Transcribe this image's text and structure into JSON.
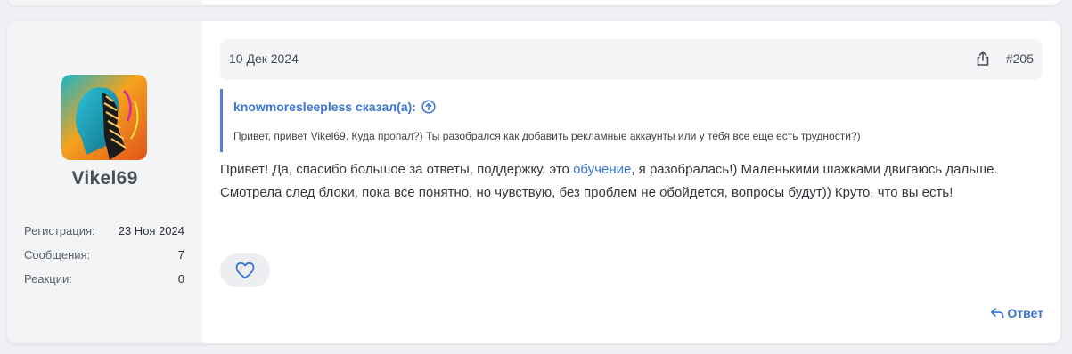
{
  "user": {
    "name": "Vikel69",
    "avatar_icon": "user-avatar-image",
    "stats": [
      {
        "label": "Регистрация:",
        "value": "23 Ноя 2024"
      },
      {
        "label": "Сообщения:",
        "value": "7"
      },
      {
        "label": "Реакции:",
        "value": "0"
      }
    ]
  },
  "post": {
    "date": "10 Дек 2024",
    "number": "#205",
    "share_icon": "share-icon"
  },
  "quote": {
    "author": "knowmoresleepless сказал(а):",
    "text": "Привет, привет Vikel69. Куда пропал?) Ты разобрался как добавить рекламные аккаунты или у тебя все еще есть трудности?)"
  },
  "message": {
    "part1": "Привет! Да, спасибо большое за ответы, поддержку, это ",
    "link": "обучение",
    "part2": ", я разобралась!) Маленькими шажками двигаюсь дальше. Смотрела след блоки, пока все понятно, но чувствую, без проблем не обойдется, вопросы будут)) Круто, что вы есть!"
  },
  "actions": {
    "like_icon": "heart-icon",
    "reply_label": "Ответ",
    "reply_icon": "reply-icon"
  },
  "colors": {
    "accent": "#3a74d8",
    "sidebar_bg": "#f3f4f6",
    "page_bg": "#eef0f3"
  }
}
